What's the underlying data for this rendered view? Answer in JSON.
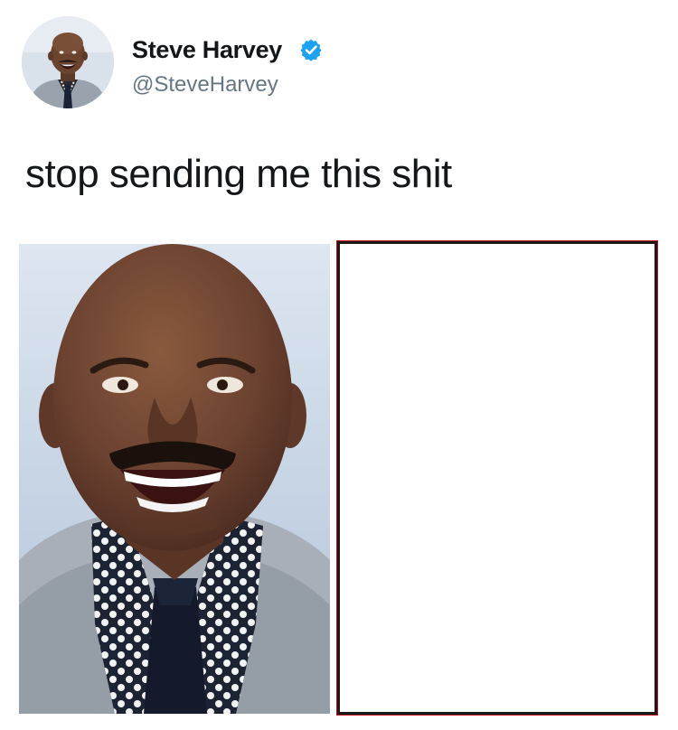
{
  "author": {
    "display_name": "Steve Harvey",
    "handle": "@SteveHarvey",
    "verified": true,
    "avatar_icon": "profile-photo-icon",
    "verified_icon": "verified-badge-icon",
    "verified_color": "#1da1f2"
  },
  "tweet": {
    "text": "stop sending me this shit"
  },
  "media": {
    "left_image": "smiling-man-in-suit-photo",
    "right_panel": "blank-white-panel",
    "right_panel_border_color": "#c0121b"
  }
}
